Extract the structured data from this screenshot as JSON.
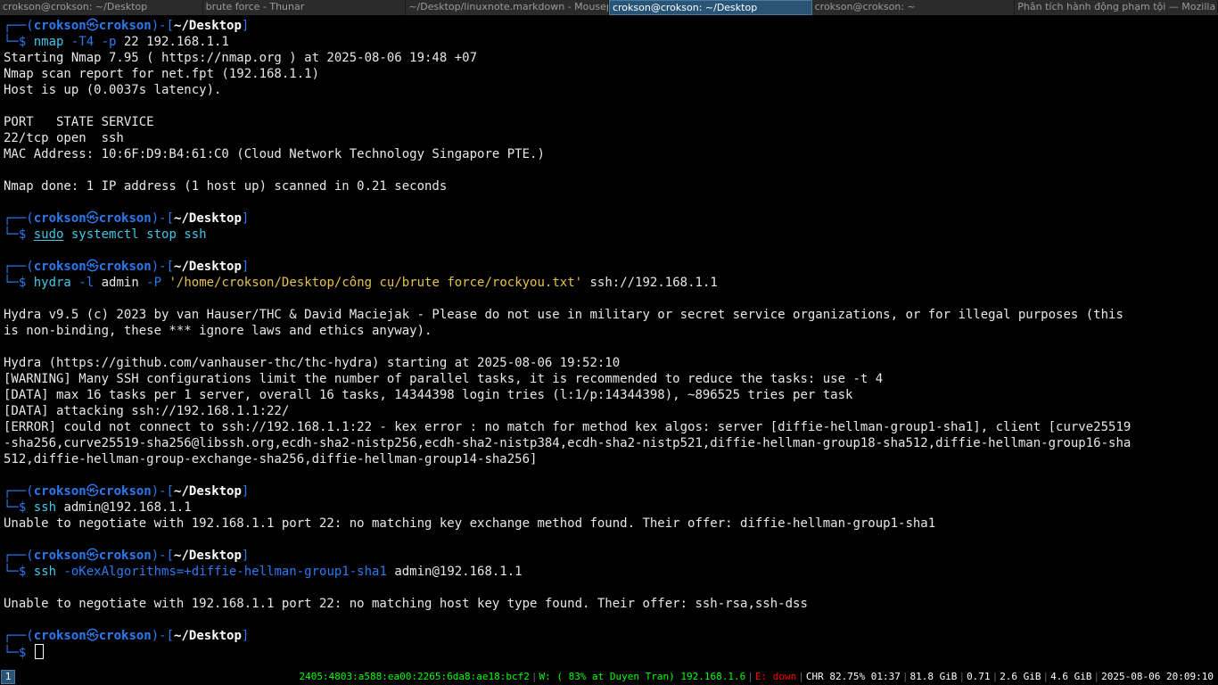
{
  "tabs": [
    {
      "label": "crokson@crokson: ~/Desktop",
      "active": false
    },
    {
      "label": "brute force - Thunar",
      "active": false
    },
    {
      "label": "~/Desktop/linuxnote.markdown - Mousepad",
      "active": false
    },
    {
      "label": "crokson@crokson: ~/Desktop",
      "active": true
    },
    {
      "label": "crokson@crokson: ~",
      "active": false
    },
    {
      "label": "Phân tích hành động phạm tội — Mozilla Firefox",
      "active": false
    }
  ],
  "prompt": {
    "open": "┌──(",
    "user": "crokson",
    "skull": "㉿",
    "host": "crokson",
    "mid": ")-[",
    "cwd": "~/Desktop",
    "close": "]",
    "second": "└─",
    "dollar": "$ "
  },
  "terminal": {
    "cmd1": {
      "prog": "nmap",
      "opt1": " -T4",
      "opt2": " -p",
      "rest": " 22 192.168.1.1"
    },
    "out1": [
      "Starting Nmap 7.95 ( https://nmap.org ) at 2025-08-06 19:48 +07",
      "Nmap scan report for net.fpt (192.168.1.1)",
      "Host is up (0.0037s latency).",
      "",
      "PORT   STATE SERVICE",
      "22/tcp open  ssh",
      "MAC Address: 10:6F:D9:B4:61:C0 (Cloud Network Technology Singapore PTE.)",
      "",
      "Nmap done: 1 IP address (1 host up) scanned in 0.21 seconds"
    ],
    "cmd2": {
      "sudo": "sudo",
      "prog": " systemctl",
      "rest": " stop ssh"
    },
    "cmd3": {
      "prog": "hydra",
      "opt1": " -l",
      "arg1": " admin",
      "opt2": " -P",
      "path": " '/home/crokson/Desktop/công cụ/brute force/rockyou.txt'",
      "rest": " ssh://192.168.1.1"
    },
    "out3": [
      "",
      "Hydra v9.5 (c) 2023 by van Hauser/THC & David Maciejak - Please do not use in military or secret service organizations, or for illegal purposes (this",
      "is non-binding, these *** ignore laws and ethics anyway).",
      "",
      "Hydra (https://github.com/vanhauser-thc/thc-hydra) starting at 2025-08-06 19:52:10",
      "[WARNING] Many SSH configurations limit the number of parallel tasks, it is recommended to reduce the tasks: use -t 4",
      "[DATA] max 16 tasks per 1 server, overall 16 tasks, 14344398 login tries (l:1/p:14344398), ~896525 tries per task",
      "[DATA] attacking ssh://192.168.1.1:22/",
      "[ERROR] could not connect to ssh://192.168.1.1:22 - kex error : no match for method kex algos: server [diffie-hellman-group1-sha1], client [curve25519",
      "-sha256,curve25519-sha256@libssh.org,ecdh-sha2-nistp256,ecdh-sha2-nistp384,ecdh-sha2-nistp521,diffie-hellman-group18-sha512,diffie-hellman-group16-sha",
      "512,diffie-hellman-group-exchange-sha256,diffie-hellman-group14-sha256]"
    ],
    "cmd4": {
      "prog": "ssh",
      "rest": " admin@192.168.1.1"
    },
    "out4": [
      "Unable to negotiate with 192.168.1.1 port 22: no matching key exchange method found. Their offer: diffie-hellman-group1-sha1"
    ],
    "cmd5": {
      "prog": "ssh",
      "opt1": " -oKexAlgorithms=+diffie-hellman-group1-sha1",
      "rest": " admin@192.168.1.1"
    },
    "out5": [
      "",
      "Unable to negotiate with 192.168.1.1 port 22: no matching host key type found. Their offer: ssh-rsa,ssh-dss"
    ]
  },
  "statusbar": {
    "workspace": "1",
    "ipv6": "2405:4803:a588:ea00:2265:6da8:ae18:bcf2",
    "wifi": "W: ( 83% at Duyen Tran) 192.168.1.6",
    "ethernet": "E: down",
    "battery": "CHR 82.75% 01:37",
    "disk": "81.8 GiB",
    "load": "0.71",
    "mem_used": "2.6 GiB",
    "mem_avail": "4.6 GiB",
    "datetime": "2025-08-06 20:09:10"
  },
  "colors": {
    "prompt_frame": "#2b7bf2",
    "command": "#41c7e8",
    "string": "#e6c34a",
    "active_tab": "#285577",
    "status_good": "#00ff00",
    "status_bad": "#ff0000"
  }
}
